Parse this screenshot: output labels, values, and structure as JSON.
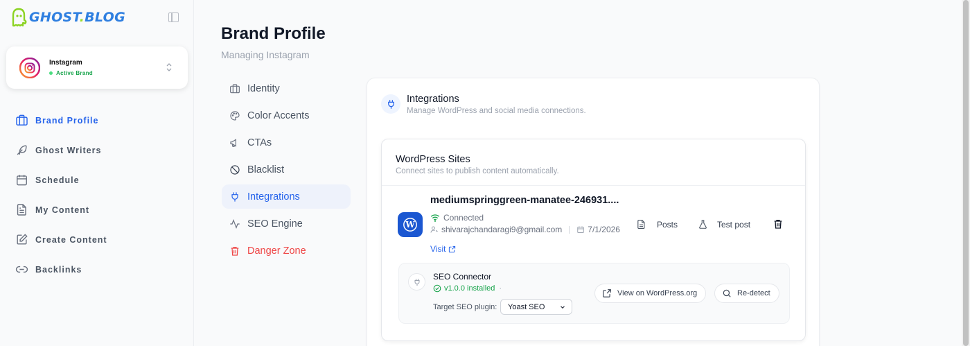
{
  "app": {
    "logo_text_1": "GHOST",
    "logo_dot": ".",
    "logo_text_2": "BLOG"
  },
  "brand": {
    "name": "Instagram",
    "status": "Active Brand"
  },
  "sidebar": {
    "items": [
      {
        "label": "Brand Profile",
        "icon": "briefcase-icon",
        "active": true
      },
      {
        "label": "Ghost Writers",
        "icon": "feather-icon"
      },
      {
        "label": "Schedule",
        "icon": "calendar-icon"
      },
      {
        "label": "My Content",
        "icon": "document-icon"
      },
      {
        "label": "Create Content",
        "icon": "edit-icon"
      },
      {
        "label": "Backlinks",
        "icon": "link-icon"
      }
    ]
  },
  "header": {
    "title": "Brand Profile",
    "subtitle": "Managing Instagram"
  },
  "subnav": {
    "items": [
      {
        "label": "Identity",
        "icon": "briefcase-icon"
      },
      {
        "label": "Color Accents",
        "icon": "palette-icon"
      },
      {
        "label": "CTAs",
        "icon": "megaphone-icon"
      },
      {
        "label": "Blacklist",
        "icon": "ban-icon"
      },
      {
        "label": "Integrations",
        "icon": "plug-icon",
        "active": true
      },
      {
        "label": "SEO Engine",
        "icon": "activity-icon"
      },
      {
        "label": "Danger Zone",
        "icon": "trash-icon",
        "danger": true
      }
    ]
  },
  "integrations": {
    "title": "Integrations",
    "subtitle": "Manage WordPress and social media connections."
  },
  "wordpress": {
    "title": "WordPress Sites",
    "subtitle": "Connect sites to publish content automatically.",
    "site": {
      "name": "mediumspringgreen-manatee-246931....",
      "status": "Connected",
      "email": "shivarajchandaragi9@gmail.com",
      "date": "7/1/2026",
      "visit_label": "Visit",
      "posts_label": "Posts",
      "test_label": "Test post"
    },
    "seo": {
      "title": "SEO Connector",
      "version": "v1.0.0 installed",
      "version_sep": "·",
      "target_label": "Target SEO plugin:",
      "selected_plugin": "Yoast SEO",
      "view_label": "View on WordPress.org",
      "redetect_label": "Re-detect"
    }
  },
  "colors": {
    "accent": "#2563eb",
    "success": "#16a34a",
    "danger": "#ef4444",
    "wp_blue": "#1b57d1"
  }
}
